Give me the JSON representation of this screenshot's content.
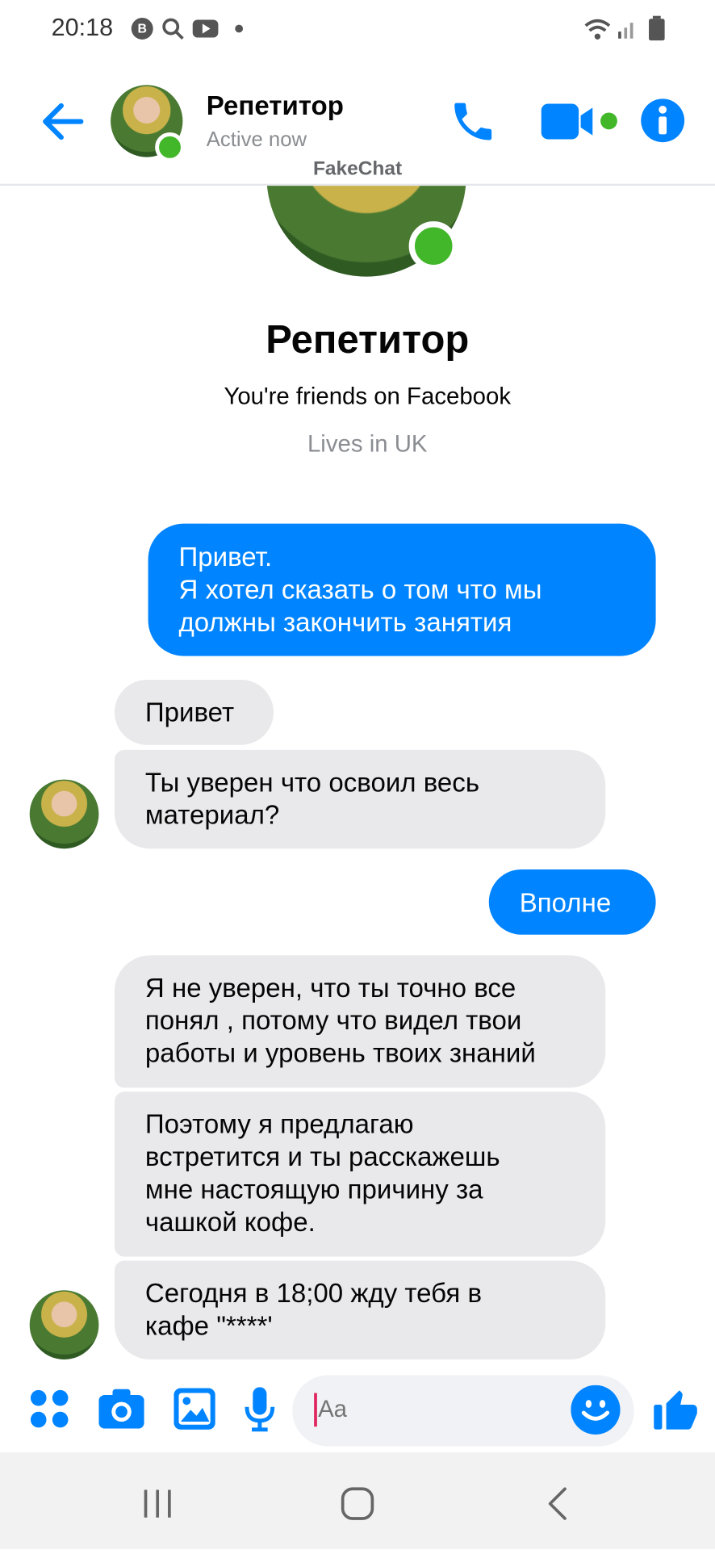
{
  "status_bar": {
    "time": "20:18",
    "badge": "B"
  },
  "header": {
    "contact_name": "Репетитор",
    "status": "Active now",
    "brand": "FakeChat"
  },
  "profile": {
    "name": "Репетитор",
    "friends_text": "You're friends on Facebook",
    "lives_text": "Lives in UK"
  },
  "messages": [
    {
      "direction": "out",
      "lines": [
        "Привет.",
        "Я хотел сказать о том что мы",
        "должны закончить занятия"
      ]
    },
    {
      "direction": "in",
      "lines": [
        "Привет"
      ]
    },
    {
      "direction": "in",
      "lines": [
        "Ты уверен что освоил весь",
        "материал?"
      ]
    },
    {
      "direction": "out",
      "lines": [
        "Вполне"
      ]
    },
    {
      "direction": "in",
      "lines": [
        "Я не уверен, что ты точно все",
        "понял , потому что видел твои",
        "работы и уровень твоих знаний"
      ]
    },
    {
      "direction": "in",
      "lines": [
        "Поэтому я предлагаю",
        "встретится и ты расскажешь",
        "мне настоящую причину за",
        "чашкой кофе."
      ]
    },
    {
      "direction": "in",
      "lines": [
        "Сегодня в 18;00 жду тебя в",
        "кафе \"****'"
      ]
    }
  ],
  "composer": {
    "placeholder": "Aa"
  },
  "colors": {
    "accent": "#0084ff",
    "online": "#42b72a",
    "incoming_bubble": "#e9e9eb"
  }
}
